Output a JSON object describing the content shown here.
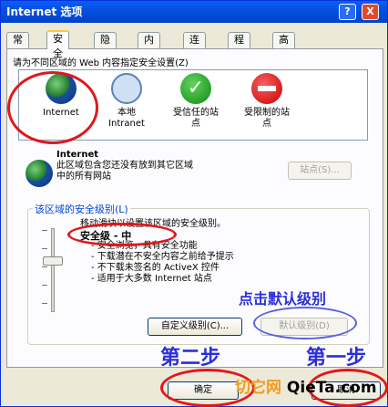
{
  "window": {
    "title": "Internet 选项",
    "help_label": "?",
    "close_label": "X"
  },
  "tabs": [
    "常规",
    "安全",
    "隐私",
    "内容",
    "连接",
    "程序",
    "高级"
  ],
  "active_tab": "安全",
  "zones": {
    "prompt": "请为不同区域的 Web 内容指定安全设置(Z)",
    "items": [
      {
        "label": "Internet",
        "icon": "globe-icon"
      },
      {
        "label": "本地\nIntranet",
        "icon": "local-intranet-icon"
      },
      {
        "label": "受信任的站\n点",
        "icon": "trusted-sites-icon"
      },
      {
        "label": "受限制的站\n点",
        "icon": "restricted-sites-icon"
      }
    ]
  },
  "selected_zone": {
    "title": "Internet",
    "description": "此区域包含您还没有放到其它区域\n中的所有网站",
    "sites_button": "站点(S)..."
  },
  "security_level": {
    "group_label": "该区域的安全级别(L)",
    "intro": "移动滑块以设置该区域的安全级别。",
    "level_name": "安全级 - 中",
    "items": [
      "安全浏览，具有安全功能",
      "下载潜在不安全内容之前给予提示",
      "不下载未签名的 ActiveX 控件",
      "适用于大多数 Internet 站点"
    ],
    "custom_button": "自定义级别(C)...",
    "default_button": "默认级别(D)"
  },
  "footer": {
    "ok_button": "确定",
    "cancel_button": "取消"
  },
  "annotations": {
    "click_default": "点击默认级别",
    "step_two": "第二步",
    "step_one": "第一步"
  },
  "watermark": {
    "text_main": "切它网",
    "text_site": "QieTa.com"
  },
  "colors": {
    "red_annotation": "#e0181c",
    "blue_annotation": "#2b2fd8",
    "watermark": "#f49a1a"
  }
}
